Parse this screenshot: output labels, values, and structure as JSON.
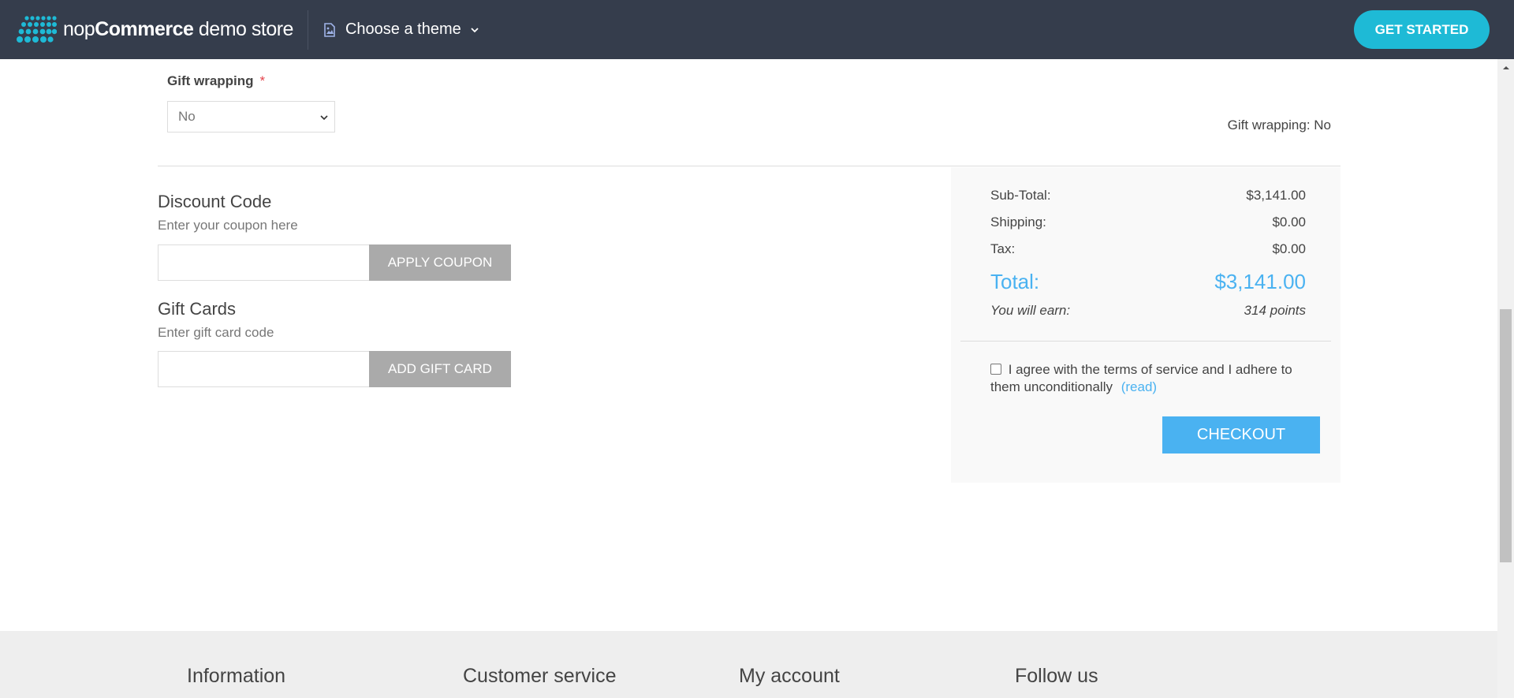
{
  "topbar": {
    "brand_light": "nop",
    "brand_bold": "Commerce",
    "brand_suffix": " demo store",
    "theme_label": "Choose a theme",
    "get_started_label": "GET STARTED",
    "bg_color": "#353d4c",
    "accent_color": "#1ebad6"
  },
  "gift_wrapping": {
    "label": "Gift wrapping",
    "required_mark": "*",
    "selected_value": "No",
    "summary": "Gift wrapping: No"
  },
  "discount": {
    "title": "Discount Code",
    "hint": "Enter your coupon here",
    "input_value": "",
    "button_label": "APPLY COUPON"
  },
  "gift_cards": {
    "title": "Gift Cards",
    "hint": "Enter gift card code",
    "input_value": "",
    "button_label": "ADD GIFT CARD"
  },
  "totals": {
    "subtotal_label": "Sub-Total:",
    "subtotal_value": "$3,141.00",
    "shipping_label": "Shipping:",
    "shipping_value": "$0.00",
    "tax_label": "Tax:",
    "tax_value": "$0.00",
    "total_label": "Total:",
    "total_value": "$3,141.00",
    "earn_label": "You will earn:",
    "earn_value": "314 points",
    "accent_color": "#4ab2f1"
  },
  "terms": {
    "text": "I agree with the terms of service and I adhere to them unconditionally",
    "read_link": "(read)",
    "checked": false
  },
  "checkout": {
    "button_label": "CHECKOUT"
  },
  "footer": {
    "columns": [
      "Information",
      "Customer service",
      "My account",
      "Follow us"
    ]
  }
}
